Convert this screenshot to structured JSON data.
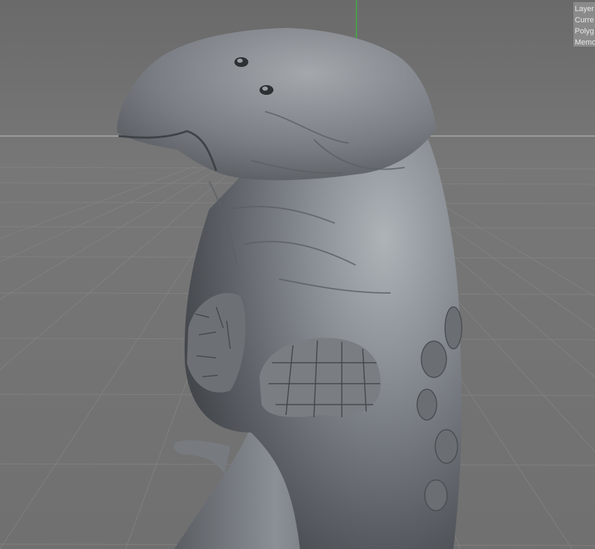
{
  "viewport": {
    "background_color": "#6f6f6f",
    "grid_color": "#828282",
    "horizon_line_color": "#c8c8c8",
    "y_axis_color": "#2bd12b",
    "model_color": "#7b7f84"
  },
  "hud": {
    "lines": [
      "Layer",
      "Curre",
      "Polyg",
      "Memo"
    ]
  }
}
